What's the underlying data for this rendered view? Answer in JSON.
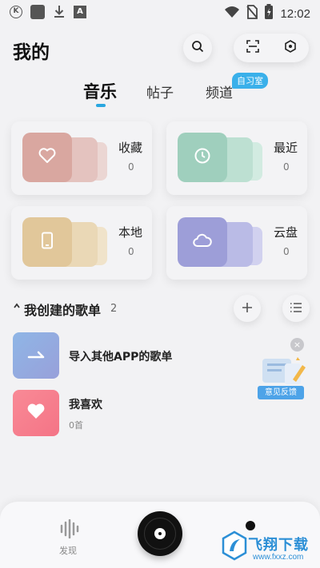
{
  "status_bar": {
    "left_icons": [
      "k-circle-icon",
      "square-icon",
      "download-icon",
      "a-icon"
    ],
    "right_icons": [
      "wifi-icon",
      "no-sim-icon",
      "battery-icon"
    ],
    "a_glyph": "A",
    "k_glyph": "K",
    "time": "12:02"
  },
  "header": {
    "title": "我的",
    "search_icon": "search-icon",
    "scan_icon": "scan-icon",
    "settings_icon": "settings-hex-icon"
  },
  "tabs": [
    {
      "label": "音乐",
      "active": true
    },
    {
      "label": "帖子",
      "active": false
    },
    {
      "label": "频道",
      "active": false
    }
  ],
  "tab_badge": "自习室",
  "accent_color": "#2aa7e0",
  "cards": [
    {
      "label": "收藏",
      "count": "0",
      "icon": "heart-icon",
      "colors": [
        "#d9a7a0",
        "#e4c3bf",
        "#ebd6d3"
      ]
    },
    {
      "label": "最近",
      "count": "0",
      "icon": "clock-icon",
      "colors": [
        "#9fcfbd",
        "#bde0d2",
        "#d2ebe1"
      ]
    },
    {
      "label": "本地",
      "count": "0",
      "icon": "phone-icon",
      "colors": [
        "#e1c79a",
        "#ead8b6",
        "#f0e3ca"
      ]
    },
    {
      "label": "云盘",
      "count": "0",
      "icon": "cloud-icon",
      "colors": [
        "#9d9ed8",
        "#babbe6",
        "#d1d1ef"
      ]
    }
  ],
  "section": {
    "title": "我创建的歌单",
    "count": "2",
    "add_icon": "plus-icon",
    "manage_icon": "list-manage-icon"
  },
  "playlists": [
    {
      "title": "导入其他APP的歌单",
      "subtitle": "",
      "icon": "import-arrow-icon",
      "color": "#8fa3dd"
    },
    {
      "title": "我喜欢",
      "subtitle": "0首",
      "icon": "heart-icon",
      "color": "#f7808f"
    }
  ],
  "feedback": {
    "label": "意见反馈",
    "close_glyph": "×"
  },
  "bottom_nav": {
    "discover_label": "发现"
  },
  "watermark": {
    "text": "飞翔下载",
    "url": "www.fxxz.com"
  }
}
